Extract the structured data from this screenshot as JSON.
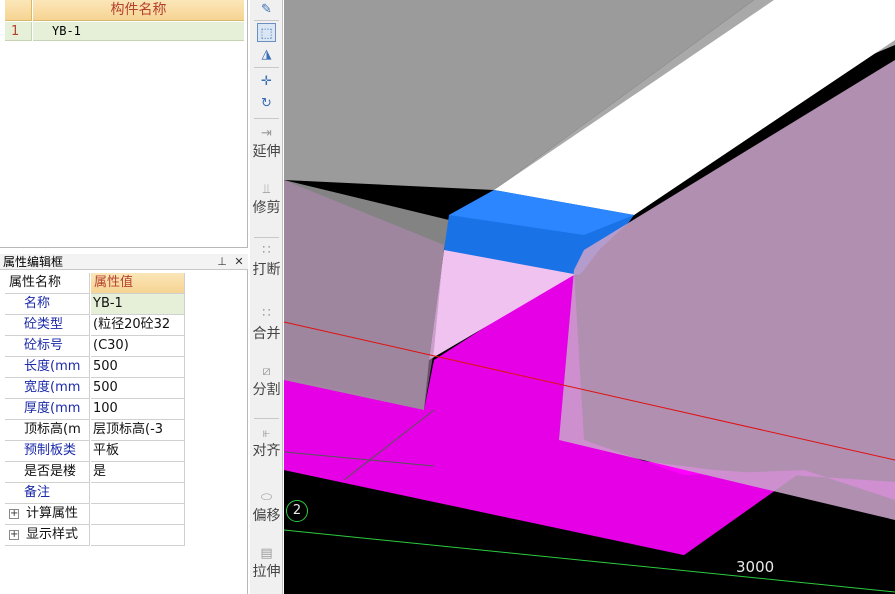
{
  "component_list": {
    "header": "构件名称",
    "rows": [
      {
        "index": "1",
        "name": "YB-1"
      }
    ]
  },
  "property_editor": {
    "title": "属性编辑框",
    "pin_icon": "pin-icon",
    "close_icon": "close-icon",
    "header_key": "属性名称",
    "header_value": "属性值",
    "rows": [
      {
        "key": "名称",
        "value": "YB-1"
      },
      {
        "key": "砼类型",
        "value": "(粒径20砼32"
      },
      {
        "key": "砼标号",
        "value": "(C30)"
      },
      {
        "key": "长度(mm",
        "value": "500"
      },
      {
        "key": "宽度(mm",
        "value": "500"
      },
      {
        "key": "厚度(mm",
        "value": "100"
      },
      {
        "key": "顶标高(m",
        "value": "层顶标高(-3"
      },
      {
        "key": "预制板类",
        "value": "平板"
      },
      {
        "key": "是否是楼",
        "value": "是"
      },
      {
        "key": "备注",
        "value": ""
      }
    ],
    "groups": [
      {
        "expander": "+",
        "label": "计算属性"
      },
      {
        "expander": "+",
        "label": "显示样式"
      }
    ]
  },
  "toolbar": {
    "tools": [
      {
        "icon": "pencil-icon"
      },
      {
        "icon": "pick-icon"
      },
      {
        "icon": "mirror-icon"
      },
      {
        "icon": "move-icon"
      },
      {
        "icon": "rotate-icon"
      },
      {
        "icon": "extend-icon",
        "label": "延伸"
      },
      {
        "icon": "trim-icon",
        "label": "修剪"
      },
      {
        "icon": "break-icon",
        "label": "打断"
      },
      {
        "icon": "merge-icon",
        "label": "合并"
      },
      {
        "icon": "split-icon",
        "label": "分割"
      },
      {
        "icon": "align-icon",
        "label": "对齐"
      },
      {
        "icon": "offset-icon",
        "label": "偏移"
      },
      {
        "icon": "stretch-icon",
        "label": "拉伸"
      }
    ]
  },
  "viewport": {
    "axis_label": "2",
    "dimension_label": "3000",
    "colors": {
      "background": "#000000",
      "slab_gray": "#9b9b9b",
      "slab_top": "#ffffff",
      "precast_slab": "#1a73e6",
      "magenta_beam": "#ff00ff",
      "translucent_beam": "#c9a3c9",
      "red_axis": "#e01010",
      "green_axis": "#2ecc40"
    }
  }
}
